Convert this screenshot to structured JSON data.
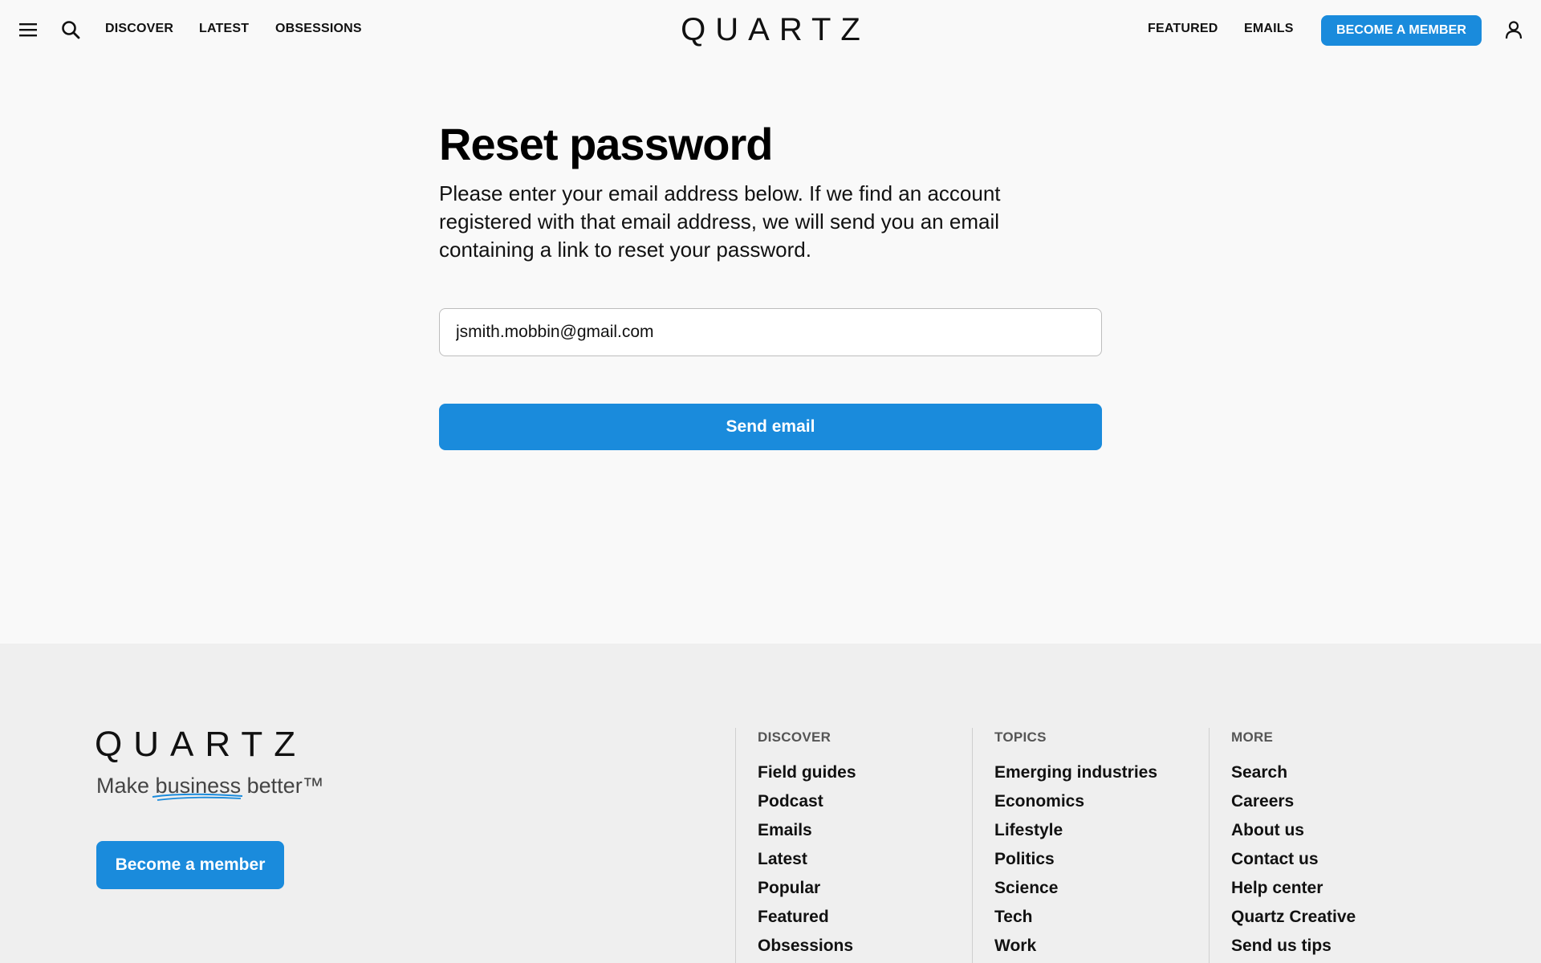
{
  "header": {
    "nav_left": [
      {
        "label": "DISCOVER"
      },
      {
        "label": "LATEST"
      },
      {
        "label": "OBSESSIONS"
      }
    ],
    "logo": "QUARTZ",
    "nav_right": [
      {
        "label": "FEATURED"
      },
      {
        "label": "EMAILS"
      }
    ],
    "member_button": "BECOME A MEMBER",
    "icons": {
      "menu": "menu-icon",
      "search": "search-icon",
      "account": "user-icon"
    }
  },
  "main": {
    "title": "Reset password",
    "description": "Please enter your email address below. If we find an account registered with that email address, we will send you an email containing a link to reset your password.",
    "email_value": "jsmith.mobbin@gmail.com",
    "send_button": "Send email"
  },
  "footer": {
    "logo": "QUARTZ",
    "tagline_before": "Make",
    "tagline_underlined": "business",
    "tagline_after": "better™",
    "member_button": "Become a member",
    "columns": [
      {
        "title": "DISCOVER",
        "links": [
          "Field guides",
          "Podcast",
          "Emails",
          "Latest",
          "Popular",
          "Featured",
          "Obsessions"
        ]
      },
      {
        "title": "TOPICS",
        "links": [
          "Emerging industries",
          "Economics",
          "Lifestyle",
          "Politics",
          "Science",
          "Tech",
          "Work"
        ]
      },
      {
        "title": "MORE",
        "links": [
          "Search",
          "Careers",
          "About us",
          "Contact us",
          "Help center",
          "Quartz Creative",
          "Send us tips"
        ]
      }
    ]
  },
  "colors": {
    "accent": "#1a8bdc",
    "page_bg": "#f9f9f9",
    "footer_bg": "#efefef"
  }
}
